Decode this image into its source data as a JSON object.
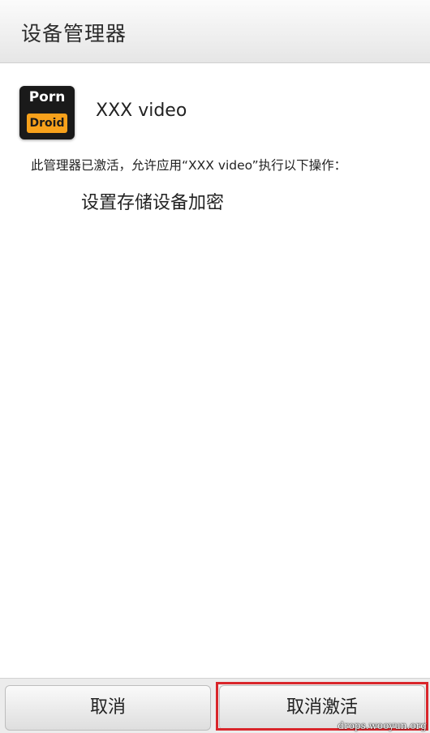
{
  "header": {
    "title": "设备管理器"
  },
  "app": {
    "icon": {
      "name": "porndroid-app-icon",
      "line1": "Porn",
      "line2": "Droid",
      "colors": {
        "background": "#1a1a1a",
        "accent": "#f7a11b"
      }
    },
    "name": "XXX video"
  },
  "content": {
    "description": "此管理器已激活，允许应用“XXX video”执行以下操作：",
    "permissions": [
      {
        "label": "设置存储设备加密"
      }
    ]
  },
  "buttons": {
    "cancel_label": "取消",
    "deactivate_label": "取消激活"
  },
  "highlight": {
    "color": "#d9262b"
  },
  "watermark": {
    "text": "drops.wooyun.org"
  }
}
